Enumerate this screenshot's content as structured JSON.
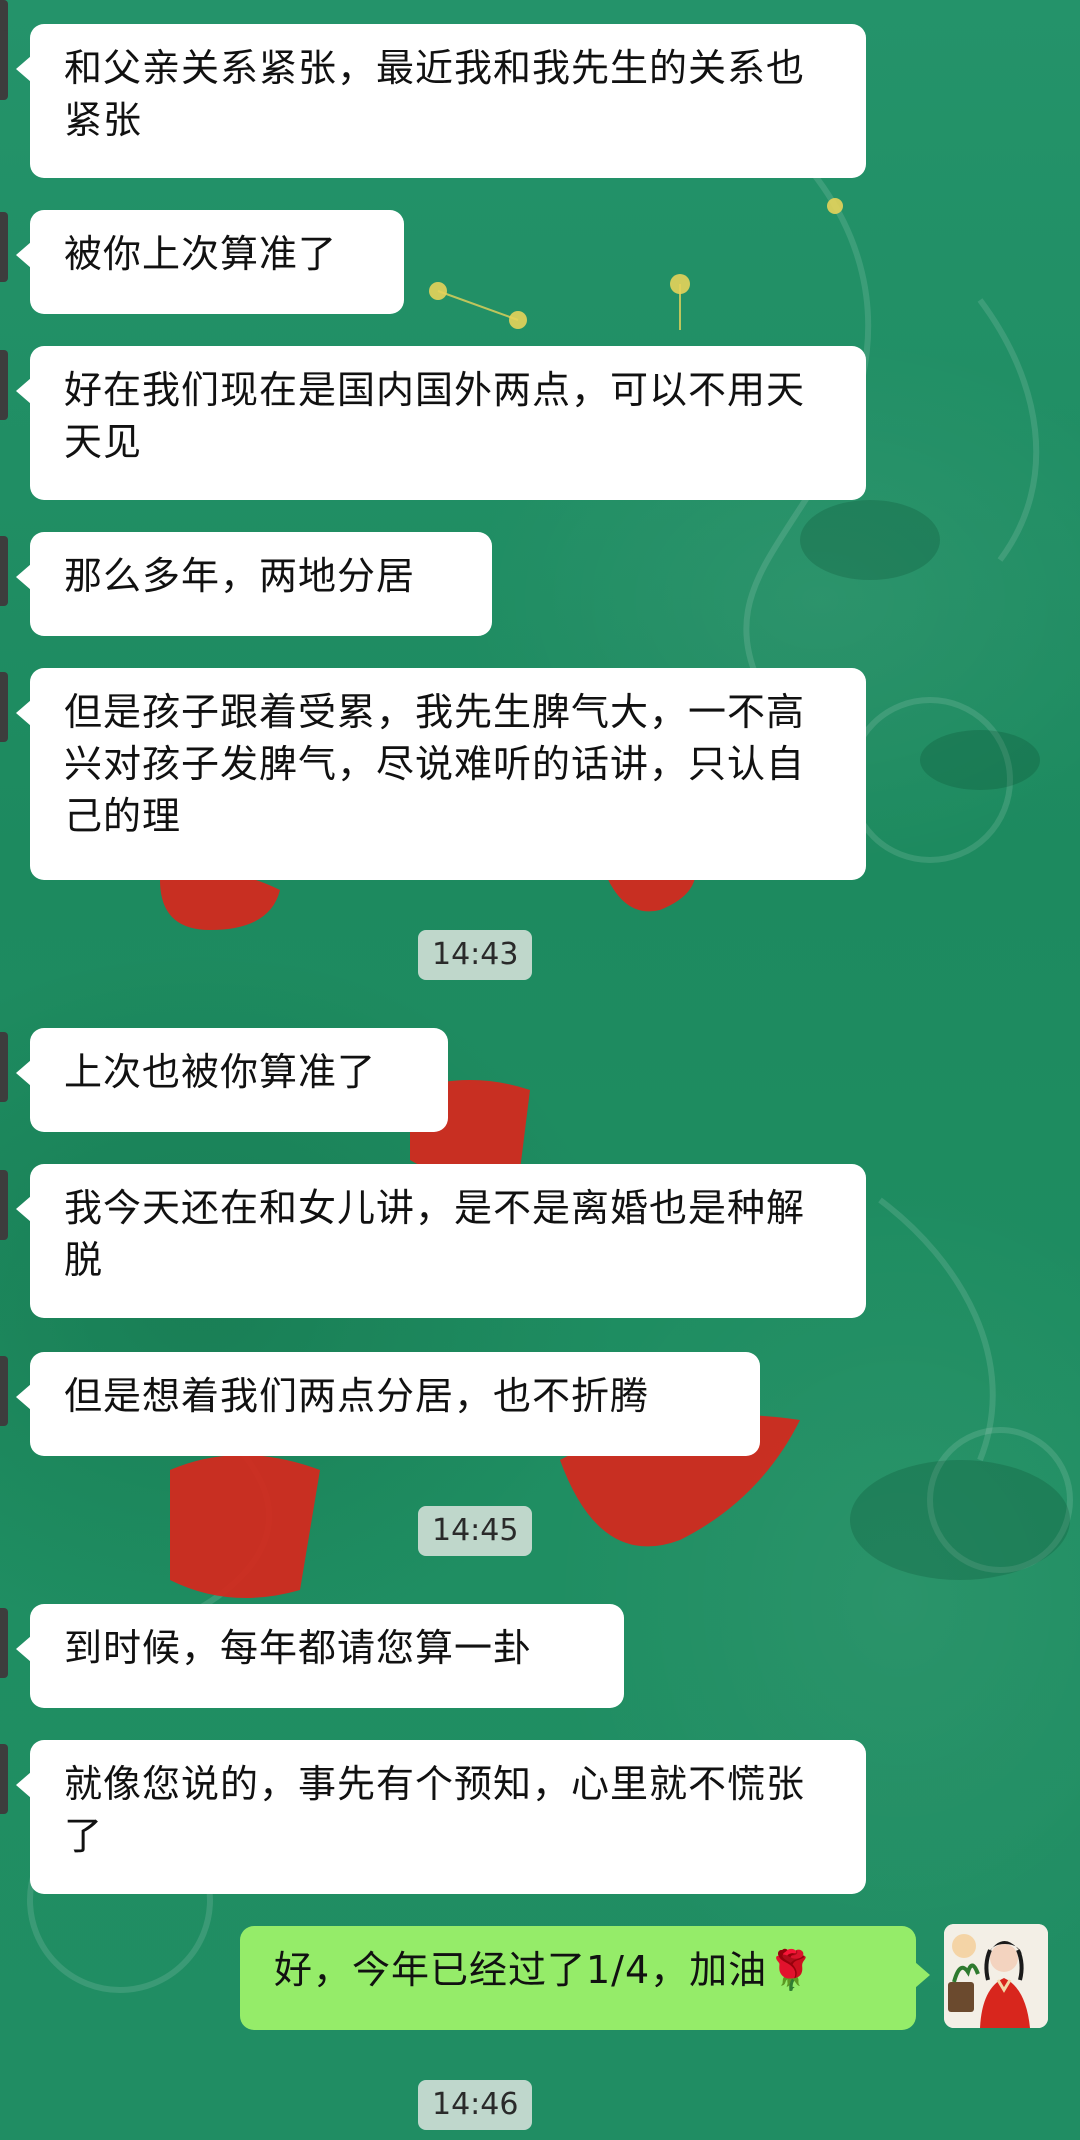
{
  "messages": [
    {
      "side": "left",
      "text": "和父亲关系紧张，最近我和我先生的关系也紧张"
    },
    {
      "side": "left",
      "text": "被你上次算准了"
    },
    {
      "side": "left",
      "text": "好在我们现在是国内国外两点，可以不用天天见"
    },
    {
      "side": "left",
      "text": "那么多年，两地分居"
    },
    {
      "side": "left",
      "text": "但是孩子跟着受累，我先生脾气大，一不高兴对孩子发脾气，尽说难听的话讲，只认自己的理"
    },
    {
      "side": "left",
      "text": "上次也被你算准了"
    },
    {
      "side": "left",
      "text": "我今天还在和女儿讲，是不是离婚也是种解脱"
    },
    {
      "side": "left",
      "text": "但是想着我们两点分居，也不折腾"
    },
    {
      "side": "left",
      "text": "到时候，每年都请您算一卦"
    },
    {
      "side": "left",
      "text": "就像您说的，事先有个预知，心里就不慌张了"
    },
    {
      "side": "right",
      "text": "好，今年已经过了1/4，加油🌹"
    }
  ],
  "timestamps": [
    "14:43",
    "14:45",
    "14:46"
  ],
  "colors": {
    "background": "#1f8f63",
    "incoming_bubble": "#ffffff",
    "outgoing_bubble": "#95ec69",
    "timestamp_bg": "#dce4de"
  },
  "icons": {
    "self_avatar": "avatar-woman-in-red-icon"
  }
}
